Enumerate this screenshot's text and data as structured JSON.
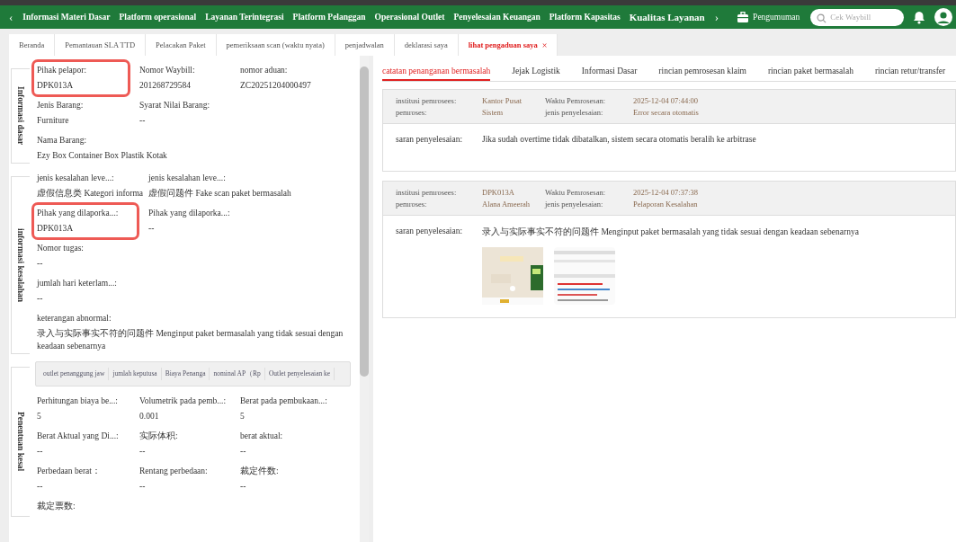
{
  "nav": {
    "items": [
      {
        "label": "Informasi Materi Dasar",
        "selected": false
      },
      {
        "label": "Platform operasional",
        "selected": false
      },
      {
        "label": "Layanan Terintegrasi",
        "selected": false
      },
      {
        "label": "Platform Pelanggan",
        "selected": false
      },
      {
        "label": "Operasional Outlet",
        "selected": false
      },
      {
        "label": "Penyelesaian Keuangan",
        "selected": false
      },
      {
        "label": "Platform Kapasitas",
        "selected": false
      },
      {
        "label": "Kualitas Layanan",
        "selected": true
      }
    ],
    "prev": "‹",
    "next": "›",
    "announcement": "Pengumuman",
    "search": {
      "placeholder": "Cek Waybill"
    }
  },
  "tabs": [
    {
      "label": "Beranda",
      "selected": false,
      "closable": false
    },
    {
      "label": "Pemantauan SLA TTD",
      "selected": false,
      "closable": false
    },
    {
      "label": "Pelacakan Paket",
      "selected": false,
      "closable": false
    },
    {
      "label": "pemeriksaan scan (waktu nyata)",
      "selected": false,
      "closable": false
    },
    {
      "label": "penjadwalan",
      "selected": false,
      "closable": false
    },
    {
      "label": "deklarasi saya",
      "selected": false,
      "closable": false
    },
    {
      "label": "lihat pengaduan saya",
      "selected": true,
      "closable": true,
      "close": "×"
    }
  ],
  "sections": [
    {
      "title": "Informasi dasar",
      "fields": [
        {
          "label": "Pihak pelapor:",
          "value": "DPK013A",
          "highlighted": true
        },
        {
          "label": "Nomor Waybill:",
          "value": "201268729584",
          "highlighted": false
        },
        {
          "label": "nomor aduan:",
          "value": "ZC20251204000497",
          "highlighted": false
        },
        {
          "label": "Jenis Barang:",
          "value": "Furniture",
          "highlighted": false
        },
        {
          "label": "Syarat Nilai Barang:",
          "value": "--",
          "highlighted": false
        },
        {
          "label": "Nama Barang:",
          "value": "Ezy Box Container Box Plastik Kotak",
          "highlighted": false,
          "wide": true
        }
      ]
    },
    {
      "title": "informasi kesalahan",
      "fields": [
        {
          "label": "jenis kesalahan leve...:",
          "value": "虚假信息类 Kategori informa",
          "highlighted": false
        },
        {
          "label": "jenis kesalahan leve...:",
          "value": "虚假问题件 Fake scan paket bermasalah",
          "highlighted": false
        },
        {
          "label": "Pihak yang dilaporka...:",
          "value": "DPK013A",
          "highlighted": true,
          "newrow": true
        },
        {
          "label": "Pihak yang dilaporka...:",
          "value": "--",
          "highlighted": false
        },
        {
          "label": "Nomor tugas:",
          "value": "--",
          "highlighted": false,
          "wide": true
        },
        {
          "label": "jumlah hari keterlam...:",
          "value": "--",
          "highlighted": false,
          "wide": true
        },
        {
          "label": "keterangan abnormal:",
          "value": "录入与实际事实不符的问题件 Menginput paket bermasalah yang tidak sesuai dengan keadaan sebenarnya",
          "highlighted": false,
          "wide": true
        }
      ]
    },
    {
      "title": "Penentuan kesal",
      "subtabs": [
        "outlet penanggung jaw",
        "jumlah keputusa",
        "Biaya Penanga",
        "nominal AP（Rp",
        "Outlet penyelesaian ke"
      ],
      "fields": [
        {
          "label": "Perhitungan biaya be...:",
          "value": "5",
          "highlighted": false
        },
        {
          "label": "Volumetrik pada pemb...:",
          "value": "0.001",
          "highlighted": false
        },
        {
          "label": "Berat pada pembukaan...:",
          "value": "5",
          "highlighted": false
        },
        {
          "label": "Berat Aktual yang Di...:",
          "value": "--",
          "highlighted": false
        },
        {
          "label": "实际体积:",
          "value": "--",
          "highlighted": false
        },
        {
          "label": "berat aktual:",
          "value": "--",
          "highlighted": false
        },
        {
          "label": "Perbedaan berat：",
          "value": "--",
          "highlighted": false
        },
        {
          "label": "Rentang perbedaan:",
          "value": "--",
          "highlighted": false
        },
        {
          "label": "裁定件数:",
          "value": "--",
          "highlighted": false
        },
        {
          "label": "裁定票数:",
          "highlighted": false
        }
      ]
    }
  ],
  "detail_tabs": [
    {
      "label": "catatan penanganan bermasalah",
      "selected": true
    },
    {
      "label": "Jejak Logistik",
      "selected": false
    },
    {
      "label": "Informasi Dasar",
      "selected": false
    },
    {
      "label": "rincian pemrosesan klaim",
      "selected": false
    },
    {
      "label": "rincian paket bermasalah",
      "selected": false
    },
    {
      "label": "rincian retur/transfer",
      "selected": false
    }
  ],
  "records": [
    {
      "institution_label": "institusi pemrosees:",
      "institution": "Kantor Pusat",
      "time_label": "Waktu Pemrosesan:",
      "time": "2025-12-04 07:44:00",
      "processor_label": "pemroses:",
      "processor": "Sistem",
      "type_label": "jenis penyelesaian:",
      "type": "Error secara otomatis",
      "advice_label": "saran penyelesaian:",
      "advice": "Jika sudah overtime tidak dibatalkan, sistem secara otomatis beralih ke arbitrase"
    },
    {
      "institution_label": "institusi pemrosees:",
      "institution": "DPK013A",
      "time_label": "Waktu Pemrosesan:",
      "time": "2025-12-04 07:37:38",
      "processor_label": "pemroses:",
      "processor": "Alana Ameerah",
      "type_label": "jenis penyelesaian:",
      "type": "Pelaporan Kesalahan",
      "advice_label": "saran penyelesaian:",
      "advice": "录入与实际事实不符的问题件 Menginput paket bermasalah yang tidak sesuai dengan keadaan sebenarnya"
    }
  ]
}
